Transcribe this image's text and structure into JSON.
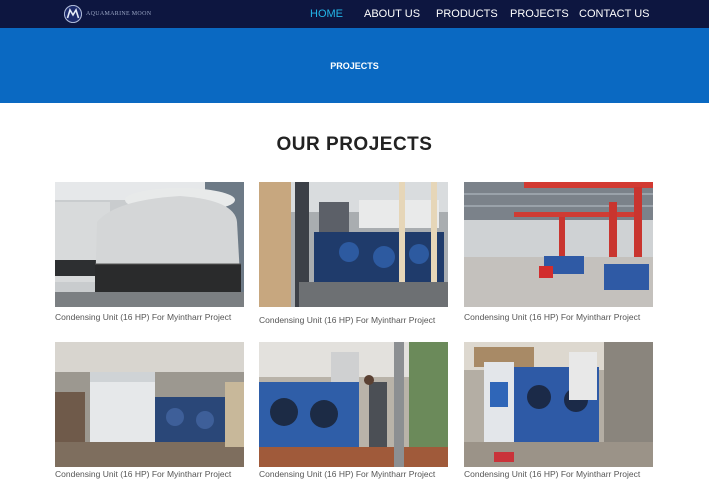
{
  "brand": {
    "logo_text": "AQUAMARINE MOON",
    "logo_icon": "aquamarine-moon-logo"
  },
  "nav": {
    "items": [
      {
        "label": "HOME",
        "active": true
      },
      {
        "label": "ABOUT US",
        "active": false
      },
      {
        "label": "PRODUCTS",
        "active": false
      },
      {
        "label": "PROJECTS",
        "active": false
      },
      {
        "label": "CONTACT US",
        "active": false
      }
    ],
    "active_color": "#23b5e8"
  },
  "hero": {
    "title": "PROJECTS",
    "background": "#0a69c2"
  },
  "section": {
    "title": "OUR PROJECTS"
  },
  "projects": [
    {
      "caption": "Condensing Unit (16 HP) For Myintharr Project",
      "image": "cooling-tower-photo"
    },
    {
      "caption": "Condensing Unit (16 HP) For Myintharr Project",
      "image": "condensing-units-row-photo"
    },
    {
      "caption": "Condensing Unit (16 HP) For Myintharr Project",
      "image": "factory-hall-red-pipes-photo"
    },
    {
      "caption": "Condensing Unit (16 HP) For Myintharr Project",
      "image": "compressor-rack-photo"
    },
    {
      "caption": "Condensing Unit (16 HP) For Myintharr Project",
      "image": "blue-condensers-worker-photo"
    },
    {
      "caption": "Condensing Unit (16 HP) For Myintharr Project",
      "image": "condensers-warehouse-photo"
    }
  ]
}
